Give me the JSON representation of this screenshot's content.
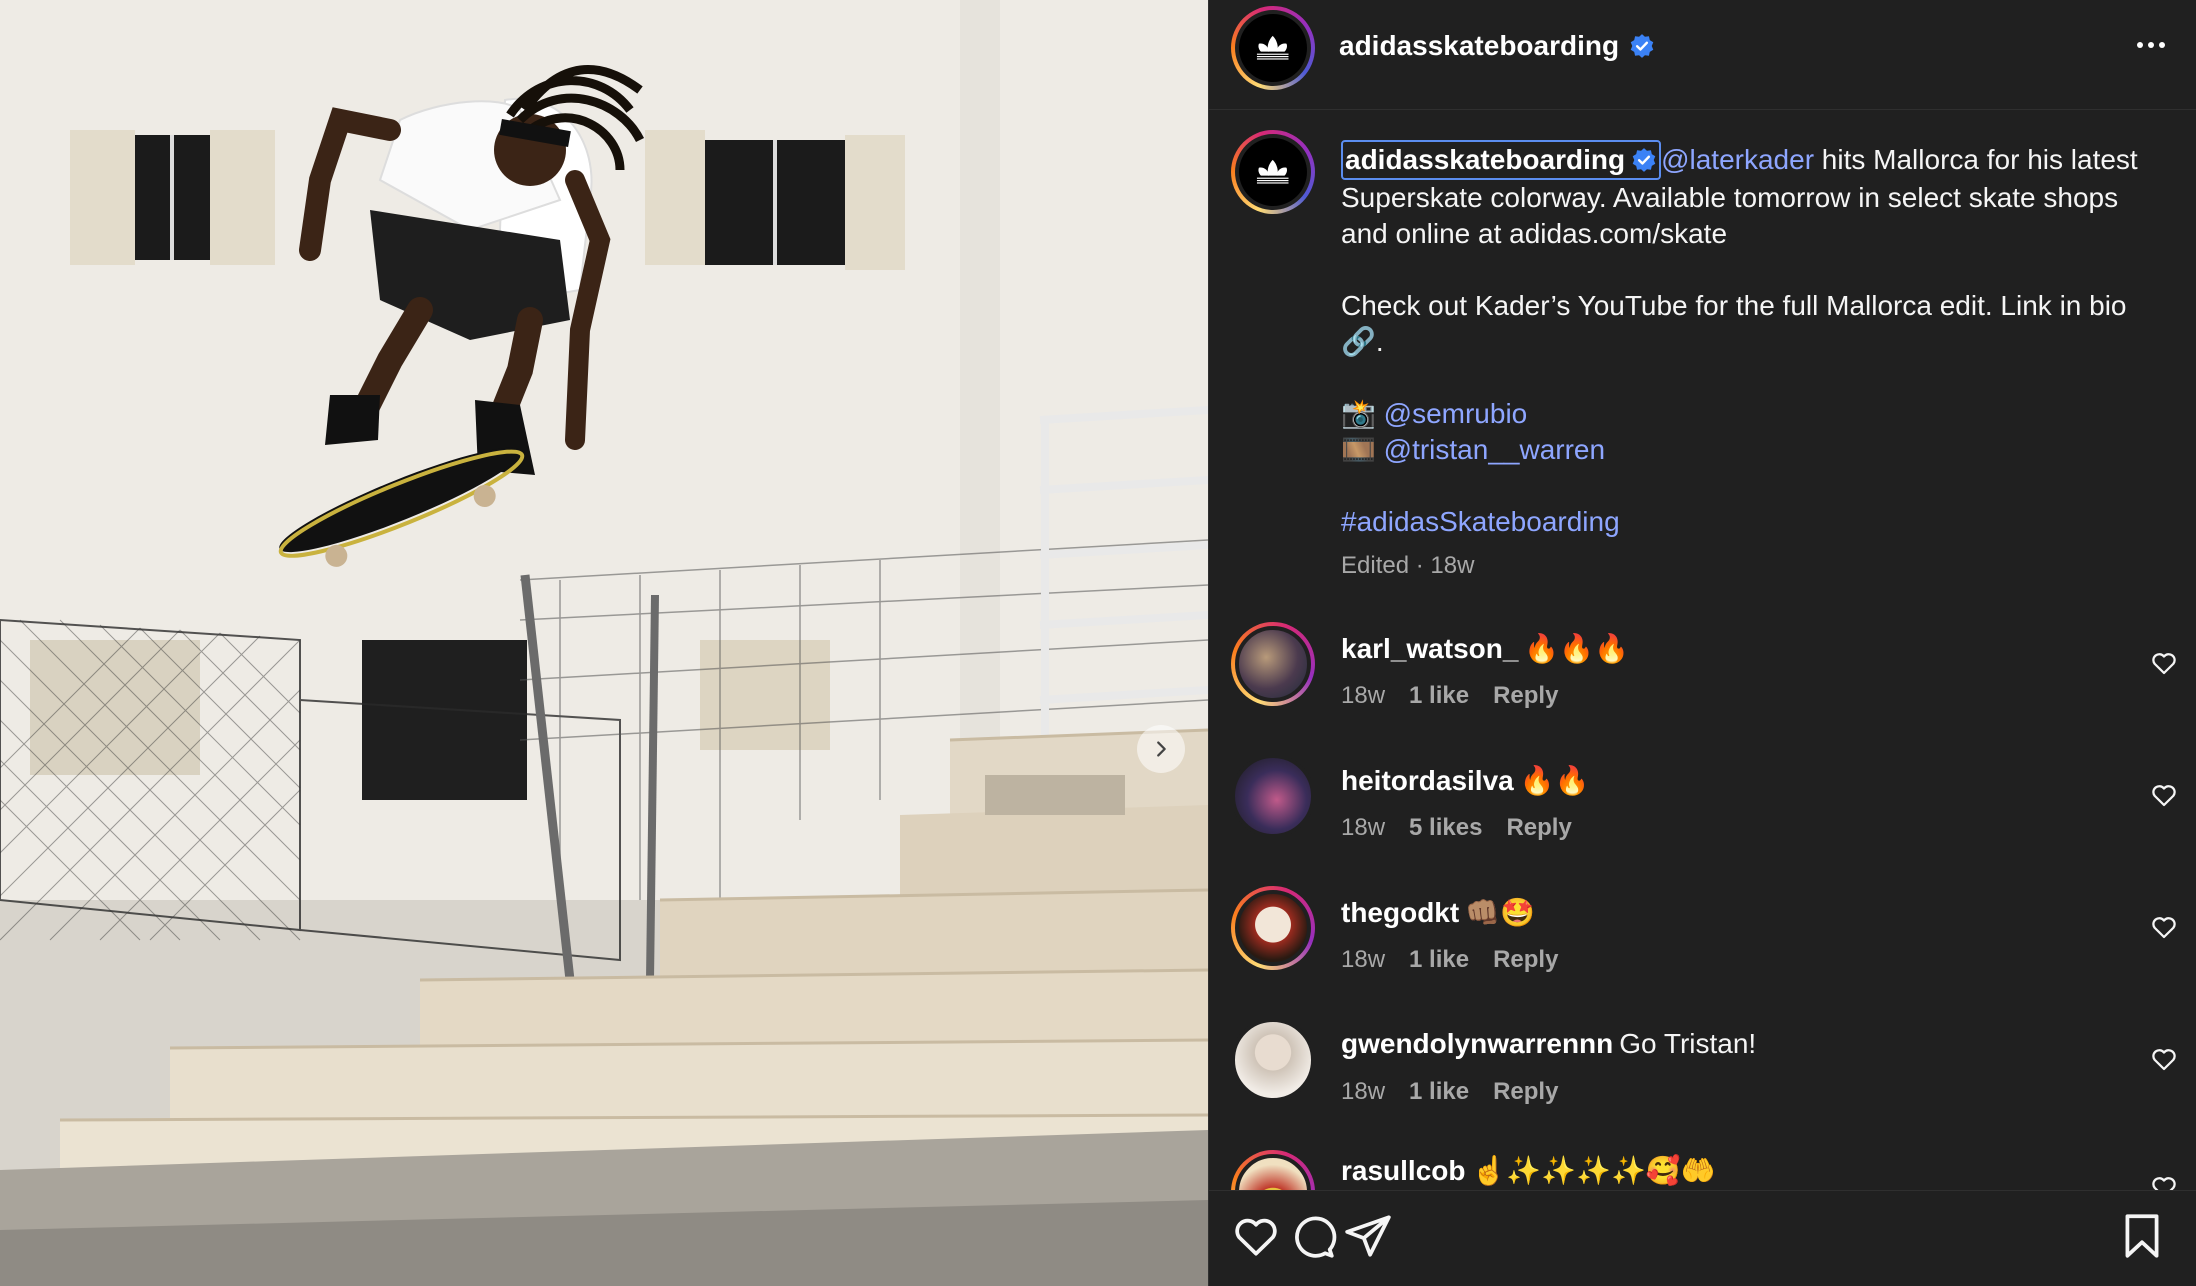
{
  "post": {
    "username": "adidasskateboarding",
    "caption_mention": "@laterkader",
    "caption_text_1": " hits Mallorca for his latest Superskate colorway. Available tomorrow in select skate shops and online at adidas.com/skate",
    "caption_text_2": "Check out Kader’s YouTube for the full Mallorca edit. Link in bio 🔗.",
    "credit_1_emoji": "📸",
    "credit_1": "@semrubio",
    "credit_2_emoji": "🎞️",
    "credit_2": "@tristan__warren",
    "hashtag": "#adidasSkateboarding",
    "meta": "Edited · 18w"
  },
  "comments": [
    {
      "username": "karl_watson_",
      "text": "🔥🔥🔥",
      "age": "18w",
      "likes": "1 like",
      "reply": "Reply"
    },
    {
      "username": "heitordasilva",
      "text": "🔥🔥",
      "age": "18w",
      "likes": "5 likes",
      "reply": "Reply"
    },
    {
      "username": "thegodkt",
      "text": "👊🏽🤩",
      "age": "18w",
      "likes": "1 like",
      "reply": "Reply"
    },
    {
      "username": "gwendolynwarrennn",
      "text": "Go Tristan!",
      "age": "18w",
      "likes": "1 like",
      "reply": "Reply"
    },
    {
      "username": "rasullcob",
      "text": "☝️✨✨✨✨🥰🤲",
      "age": "",
      "likes": "",
      "reply": ""
    }
  ],
  "icons": {
    "verified": "verified-badge-icon",
    "more": "more-options-icon",
    "like": "heart-icon",
    "comment": "comment-icon",
    "share": "share-icon",
    "save": "bookmark-icon",
    "next": "chevron-right-icon"
  },
  "colors": {
    "panel_bg": "#202020",
    "link": "#8ea6ff",
    "verified": "#3b82f6",
    "muted": "#a8a8a8"
  }
}
